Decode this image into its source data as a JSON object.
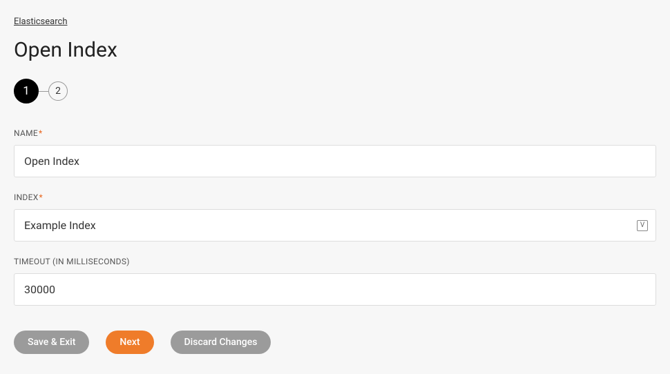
{
  "breadcrumb": {
    "label": "Elasticsearch"
  },
  "page": {
    "title": "Open Index"
  },
  "stepper": {
    "step1": "1",
    "step2": "2"
  },
  "form": {
    "name": {
      "label": "NAME",
      "required": "*",
      "value": "Open Index"
    },
    "index": {
      "label": "INDEX",
      "required": "*",
      "value": "Example Index",
      "icon_label": "V"
    },
    "timeout": {
      "label": "TIMEOUT (IN MILLISECONDS)",
      "value": "30000"
    }
  },
  "buttons": {
    "save_exit": "Save & Exit",
    "next": "Next",
    "discard": "Discard Changes"
  }
}
